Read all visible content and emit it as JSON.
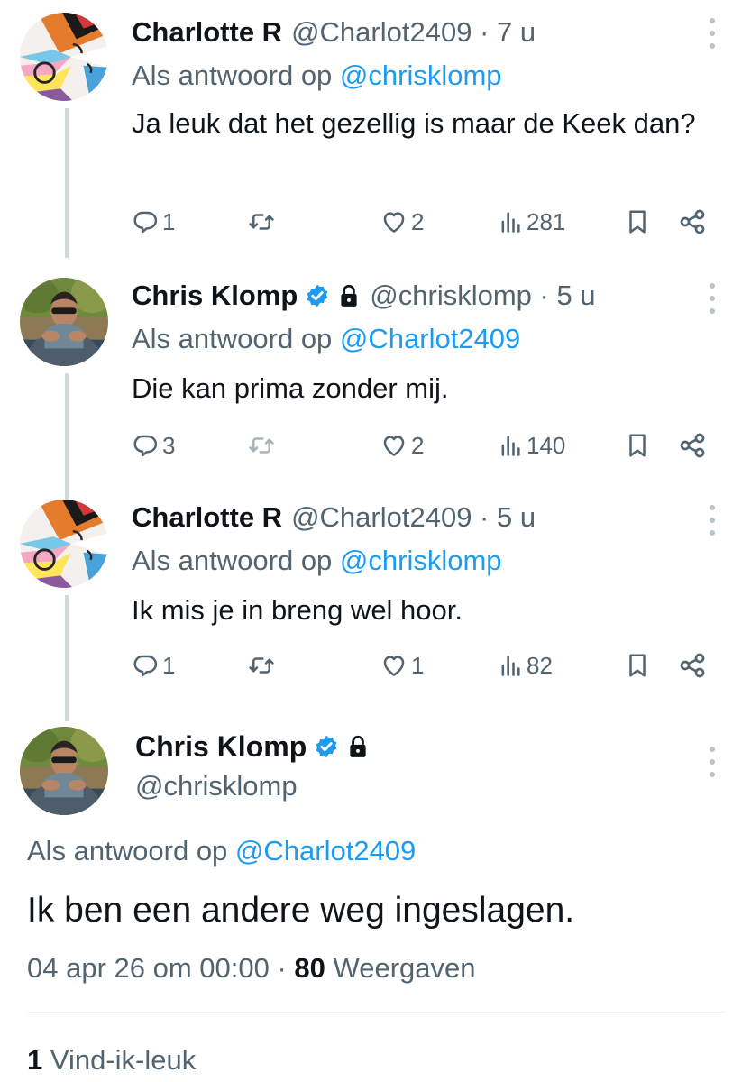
{
  "tweets": [
    {
      "name": "Charlotte R",
      "meta": "@Charlot2409 · 7 u",
      "reply_prefix": "Als antwoord op ",
      "reply_to": "@chrisklomp",
      "text": "Ja leuk dat het gezellig is maar de Keek dan?",
      "replies": "1",
      "reposts": "",
      "likes": "2",
      "views": "281",
      "verified": false,
      "locked": false
    },
    {
      "name": "Chris Klomp",
      "meta": "@chrisklomp · 5 u",
      "reply_prefix": "Als antwoord op ",
      "reply_to": "@Charlot2409",
      "text": "Die kan prima zonder mij.",
      "replies": "3",
      "reposts": "",
      "likes": "2",
      "views": "140",
      "verified": true,
      "locked": true
    },
    {
      "name": "Charlotte R",
      "meta": "@Charlot2409 · 5 u",
      "reply_prefix": "Als antwoord op ",
      "reply_to": "@chrisklomp",
      "text": "Ik mis je in breng wel hoor.",
      "replies": "1",
      "reposts": "",
      "likes": "1",
      "views": "82",
      "verified": false,
      "locked": false
    }
  ],
  "main_tweet": {
    "name": "Chris Klomp",
    "handle": "@chrisklomp",
    "reply_prefix": "Als antwoord op ",
    "reply_to": "@Charlot2409",
    "text": "Ik ben een andere weg ingeslagen.",
    "timestamp": "04 apr 26 om 00:00 · ",
    "views_count": "80",
    "views_label": " Weergaven",
    "likes_count": "1",
    "likes_label": " Vind-ik-leuk"
  },
  "colors": {
    "accent": "#1d9bf0",
    "muted": "#536471",
    "text": "#0f1419",
    "verified": "#1d9bf0"
  },
  "icons": {
    "reply": "reply-icon",
    "repost": "repost-icon",
    "like": "heart-icon",
    "views": "views-icon",
    "bookmark": "bookmark-icon",
    "share": "share-icon",
    "more": "more-vertical-icon"
  }
}
